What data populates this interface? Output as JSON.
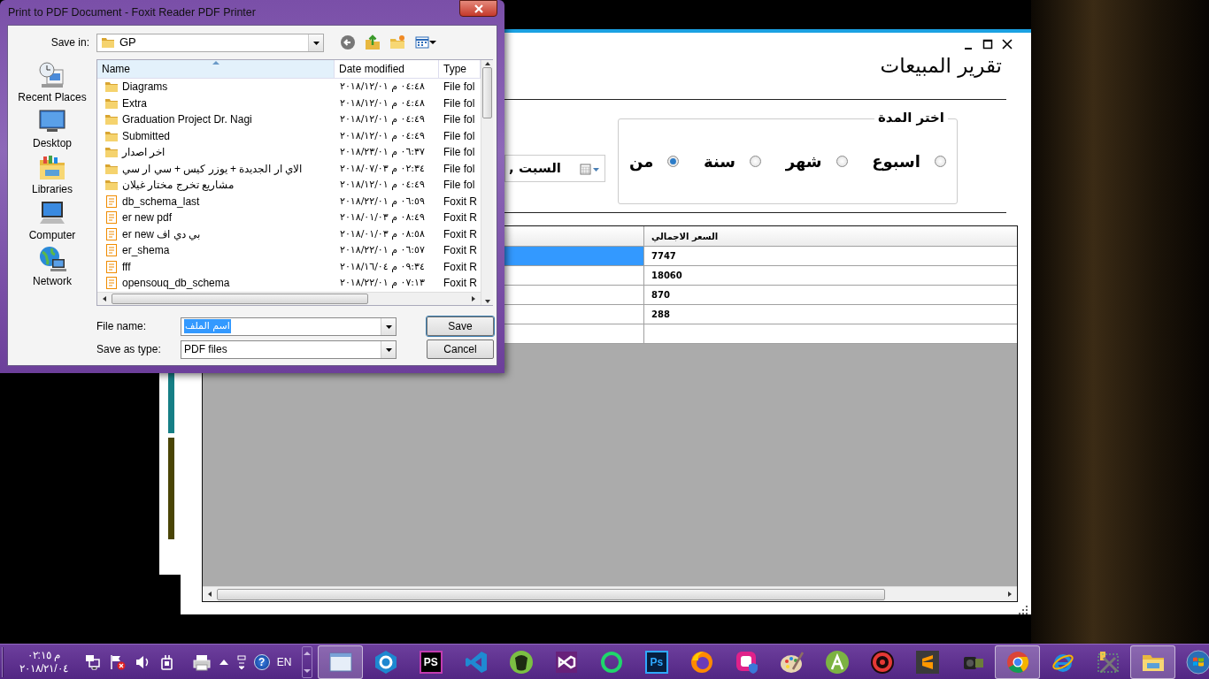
{
  "dialog": {
    "title": "Print to PDF Document - Foxit Reader PDF Printer",
    "save_in_label": "Save in:",
    "save_in_value": "GP",
    "places": [
      {
        "label": "Recent Places",
        "kind": "recent"
      },
      {
        "label": "Desktop",
        "kind": "desktop"
      },
      {
        "label": "Libraries",
        "kind": "libraries"
      },
      {
        "label": "Computer",
        "kind": "computer"
      },
      {
        "label": "Network",
        "kind": "network"
      }
    ],
    "columns": {
      "name": "Name",
      "date_modified": "Date modified",
      "type": "Type"
    },
    "files": [
      {
        "name": "Diagrams",
        "date": "٢٠١٨/١٢/٠١ م ٠٤:٤٨",
        "type": "File fol",
        "kind": "folder"
      },
      {
        "name": "Extra",
        "date": "٢٠١٨/١٢/٠١ م ٠٤:٤٨",
        "type": "File fol",
        "kind": "folder"
      },
      {
        "name": "Graduation Project Dr. Nagi",
        "date": "٢٠١٨/١٢/٠١ م ٠٤:٤٩",
        "type": "File fol",
        "kind": "folder"
      },
      {
        "name": "Submitted",
        "date": "٢٠١٨/١٢/٠١ م ٠٤:٤٩",
        "type": "File fol",
        "kind": "folder"
      },
      {
        "name": "اخر اصدار",
        "date": "٢٠١٨/٢٣/٠١ م ٠٦:٣٧",
        "type": "File fol",
        "kind": "folder"
      },
      {
        "name": "الاي ار الجديدة + يوزر كيس + سي ار سي",
        "date": "٢٠١٨/٠٧/٠٣ م ٠٢:٣٤",
        "type": "File fol",
        "kind": "folder"
      },
      {
        "name": "مشاريع تخرج مختار غيلان",
        "date": "٢٠١٨/١٢/٠١ م ٠٤:٤٩",
        "type": "File fol",
        "kind": "folder"
      },
      {
        "name": "db_schema_last",
        "date": "٢٠١٨/٢٢/٠١ م ٠٦:٥٩",
        "type": "Foxit R",
        "kind": "pdf"
      },
      {
        "name": "er new pdf",
        "date": "٢٠١٨/٠١/٠٣ م ٠٨:٤٩",
        "type": "Foxit R",
        "kind": "pdf"
      },
      {
        "name": "er new بي دي اف",
        "date": "٢٠١٨/٠١/٠٣ م ٠٨:٥٨",
        "type": "Foxit R",
        "kind": "pdf"
      },
      {
        "name": "er_shema",
        "date": "٢٠١٨/٢٢/٠١ م ٠٦:٥٧",
        "type": "Foxit R",
        "kind": "pdf"
      },
      {
        "name": "fff",
        "date": "٢٠١٨/١٦/٠٤ م ٠٩:٣٤",
        "type": "Foxit R",
        "kind": "pdf"
      },
      {
        "name": "opensouq_db_schema",
        "date": "٢٠١٨/٢٢/٠١ م ٠٧:١٣",
        "type": "Foxit R",
        "kind": "pdf"
      }
    ],
    "file_name_label": "File name:",
    "file_name_value": "اسم الملف",
    "save_type_label": "Save as type:",
    "save_type_value": "PDF files",
    "buttons": [
      "Save",
      "Cancel"
    ]
  },
  "app": {
    "title": "تقرير المبيعات",
    "period_legend": "اختر المدة",
    "periods": [
      {
        "label": "اسبوع",
        "selected": false
      },
      {
        "label": "شهر",
        "selected": false
      },
      {
        "label": "سنة",
        "selected": false
      },
      {
        "label": "من",
        "selected": true
      }
    ],
    "date_value": "السبت ,",
    "table": {
      "columns": [
        {
          "label": "السعر الاجمالي"
        }
      ],
      "rows": [
        {
          "total": "7747",
          "selected": true
        },
        {
          "total": "18060",
          "selected": false
        },
        {
          "total": "870",
          "selected": false
        },
        {
          "total": "288",
          "selected": false
        }
      ]
    }
  },
  "taskbar": {
    "time": "٠٢:١٥ م",
    "date": "٢٠١٨/٢١/٠٤",
    "help_glyph": "?",
    "language": "EN",
    "apps": [
      {
        "kind": "orb",
        "selected": false
      },
      {
        "kind": "folder",
        "selected": true
      },
      {
        "kind": "tools",
        "selected": false
      },
      {
        "kind": "orbit",
        "selected": false
      },
      {
        "kind": "wheel",
        "selected": true
      },
      {
        "kind": "camera",
        "selected": false
      },
      {
        "kind": "zigzag",
        "selected": false
      },
      {
        "kind": "target",
        "selected": false
      },
      {
        "kind": "triangle-circle",
        "selected": false
      },
      {
        "kind": "palette",
        "selected": false
      },
      {
        "kind": "shield-square",
        "selected": false
      },
      {
        "kind": "fox",
        "selected": false
      },
      {
        "kind": "blue-tile",
        "label": "Ps",
        "selected": false
      },
      {
        "kind": "ring",
        "selected": false
      },
      {
        "kind": "infinity",
        "selected": false
      },
      {
        "kind": "frog",
        "selected": false
      },
      {
        "kind": "ribbon",
        "selected": false
      },
      {
        "kind": "dark-tile",
        "label": "PS",
        "selected": false
      },
      {
        "kind": "hexagon",
        "selected": false
      },
      {
        "kind": "window",
        "selected": true
      }
    ]
  }
}
